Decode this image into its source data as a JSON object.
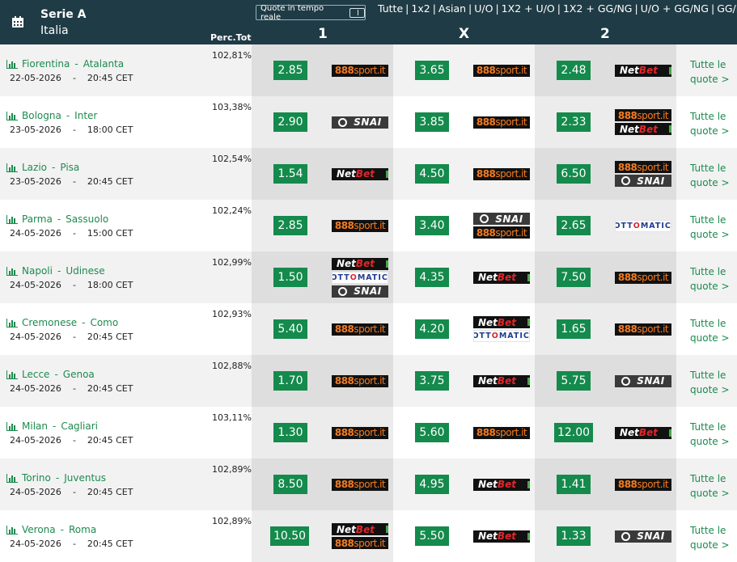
{
  "header": {
    "league": "Serie A",
    "country": "Italia",
    "perc_label": "Perc.Tot",
    "realtime_label": "Quote in tempo reale",
    "calendar_icon": "calendar-icon",
    "toggle_icon": "toggle-icon",
    "markets": [
      "Tutte",
      "1x2",
      "Asian",
      "U/O",
      "1X2 + U/O",
      "1X2 + GG/NG",
      "U/O + GG/NG",
      "GG/NG"
    ],
    "col_1": "1",
    "col_x": "X",
    "col_2": "2"
  },
  "colors": {
    "header_bg": "#1f3b45",
    "odds_green": "#148a4c",
    "team_link": "#1d8a4f"
  },
  "rows": [
    {
      "home": "Fiorentina",
      "away": "Atalanta",
      "date": "22-05-2026",
      "time": "20:45 CET",
      "perc": "102,81%",
      "o1": "2.85",
      "b1": [
        "888sport"
      ],
      "ox": "3.65",
      "bx": [
        "888sport"
      ],
      "o2": "2.48",
      "b2": [
        "netbet"
      ],
      "all": "Tutte le quote >"
    },
    {
      "home": "Bologna",
      "away": "Inter",
      "date": "23-05-2026",
      "time": "18:00 CET",
      "perc": "103,38%",
      "o1": "2.90",
      "b1": [
        "snai"
      ],
      "ox": "3.85",
      "bx": [
        "888sport"
      ],
      "o2": "2.33",
      "b2": [
        "888sport",
        "netbet"
      ],
      "all": "Tutte le quote >"
    },
    {
      "home": "Lazio",
      "away": "Pisa",
      "date": "23-05-2026",
      "time": "20:45 CET",
      "perc": "102,54%",
      "o1": "1.54",
      "b1": [
        "netbet"
      ],
      "ox": "4.50",
      "bx": [
        "888sport"
      ],
      "o2": "6.50",
      "b2": [
        "888sport",
        "snai"
      ],
      "all": "Tutte le quote >"
    },
    {
      "home": "Parma",
      "away": "Sassuolo",
      "date": "24-05-2026",
      "time": "15:00 CET",
      "perc": "102,24%",
      "o1": "2.85",
      "b1": [
        "888sport"
      ],
      "ox": "3.40",
      "bx": [
        "snai",
        "888sport"
      ],
      "o2": "2.65",
      "b2": [
        "lottomatica"
      ],
      "all": "Tutte le quote >"
    },
    {
      "home": "Napoli",
      "away": "Udinese",
      "date": "24-05-2026",
      "time": "18:00 CET",
      "perc": "102,99%",
      "o1": "1.50",
      "b1": [
        "netbet",
        "lottomatica",
        "snai"
      ],
      "ox": "4.35",
      "bx": [
        "netbet"
      ],
      "o2": "7.50",
      "b2": [
        "888sport"
      ],
      "all": "Tutte le quote >"
    },
    {
      "home": "Cremonese",
      "away": "Como",
      "date": "24-05-2026",
      "time": "20:45 CET",
      "perc": "102,93%",
      "o1": "5.40",
      "b1": [
        "888sport"
      ],
      "ox": "4.20",
      "bx": [
        "netbet",
        "lottomatica"
      ],
      "o2": "1.65",
      "b2": [
        "888sport"
      ],
      "all": "Tutte le quote >"
    },
    {
      "home": "Lecce",
      "away": "Genoa",
      "date": "24-05-2026",
      "time": "20:45 CET",
      "perc": "102,88%",
      "o1": "1.70",
      "b1": [
        "888sport"
      ],
      "ox": "3.75",
      "bx": [
        "netbet"
      ],
      "o2": "5.75",
      "b2": [
        "snai"
      ],
      "all": "Tutte le quote >"
    },
    {
      "home": "Milan",
      "away": "Cagliari",
      "date": "24-05-2026",
      "time": "20:45 CET",
      "perc": "103,11%",
      "o1": "1.30",
      "b1": [
        "888sport"
      ],
      "ox": "5.60",
      "bx": [
        "888sport"
      ],
      "o2": "12.00",
      "b2": [
        "netbet"
      ],
      "all": "Tutte le quote >"
    },
    {
      "home": "Torino",
      "away": "Juventus",
      "date": "24-05-2026",
      "time": "20:45 CET",
      "perc": "102,89%",
      "o1": "8.50",
      "b1": [
        "888sport"
      ],
      "ox": "4.95",
      "bx": [
        "netbet"
      ],
      "o2": "1.41",
      "b2": [
        "888sport"
      ],
      "all": "Tutte le quote >"
    },
    {
      "home": "Verona",
      "away": "Roma",
      "date": "24-05-2026",
      "time": "20:45 CET",
      "perc": "102,89%",
      "o1": "10.50",
      "b1": [
        "netbet",
        "888sport"
      ],
      "ox": "5.50",
      "bx": [
        "netbet"
      ],
      "o2": "1.33",
      "b2": [
        "snai"
      ],
      "all": "Tutte le quote >"
    }
  ]
}
